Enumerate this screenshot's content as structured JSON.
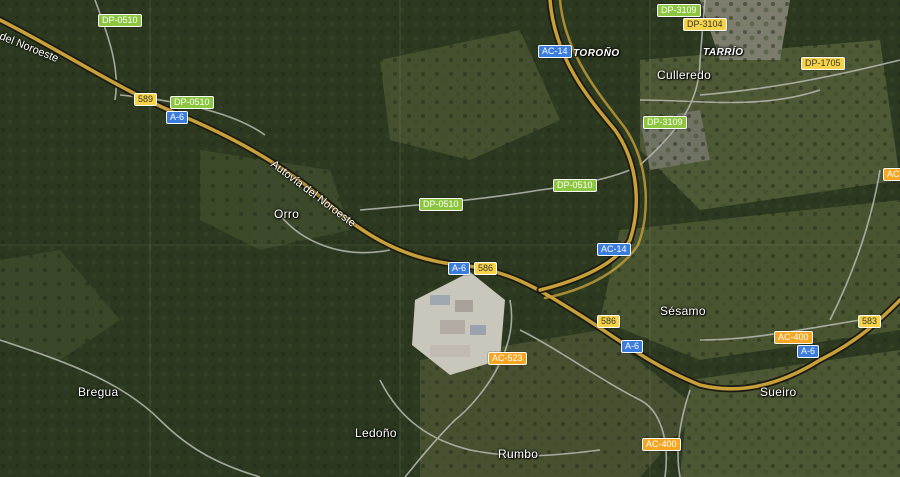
{
  "map": {
    "colors": {
      "forest": "#2c3920",
      "field": "#55603a",
      "motorway": "#c8a03a",
      "road": "#b9bcb4",
      "shield_green": "#8cc63f",
      "shield_blue": "#3b7ddd",
      "shield_orange": "#f5a623",
      "shield_yellow": "#f7d447"
    },
    "places": {
      "culleredo": "Culleredo",
      "tarrio": "TARRÍO",
      "toronho": "TOROÑO",
      "orro": "Orro",
      "sesamo": "Sésamo",
      "sueiro": "Sueiro",
      "bregua": "Bregua",
      "ledonho": "Ledoño",
      "rumbo": "Rumbo"
    },
    "road_names": {
      "del_noroeste": "del Noroeste",
      "autovia": "Autovía del Noroeste"
    },
    "shields": {
      "dp0510_a": "DP-0510",
      "r589": "589",
      "dp0510_b": "DP-0510",
      "a6_a": "A-6",
      "ac14_a": "AC-14",
      "dp3109_a": "DP-3109",
      "dp3104": "DP-3104",
      "dp1705": "DP-1705",
      "dp3109_b": "DP-3109",
      "dp0510_c": "DP-0510",
      "dp0510_d": "DP-0510",
      "ac14_b": "AC-14",
      "a6_b": "A-6",
      "r586_a": "586",
      "r586_b": "586",
      "ac523": "AC-523",
      "a6_c": "A-6",
      "ac400_a": "AC-400",
      "a6_d": "A-6",
      "r583": "583",
      "ac_edge": "AC-",
      "ac400_b": "AC-400"
    }
  }
}
